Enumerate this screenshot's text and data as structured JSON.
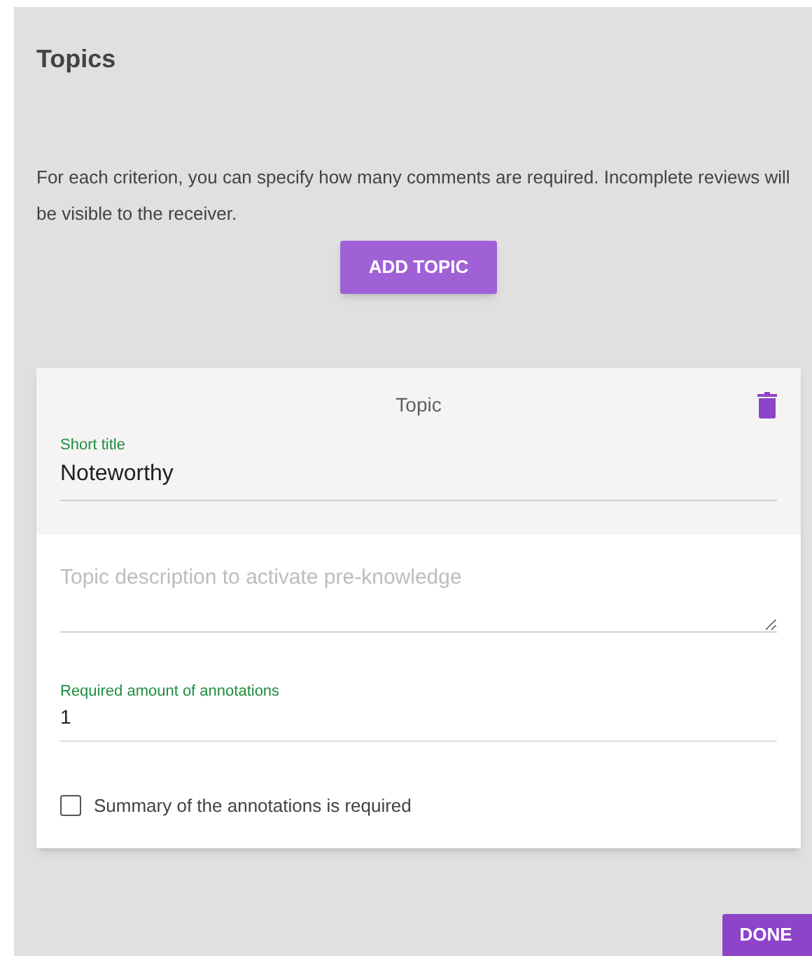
{
  "title": "Topics",
  "description": "For each criterion, you can specify how many comments are required. Incomplete reviews will be visible to the receiver.",
  "add_button": "ADD TOPIC",
  "topic": {
    "heading": "Topic",
    "short_title": {
      "label": "Short title",
      "value": "Noteworthy"
    },
    "description_field": {
      "placeholder": "Topic description to activate pre-knowledge"
    },
    "required_amount": {
      "label": "Required amount of annotations",
      "value": "1"
    },
    "summary_checkbox": {
      "label": "Summary of the annotations is required",
      "checked": false
    }
  },
  "done_button": "DONE"
}
